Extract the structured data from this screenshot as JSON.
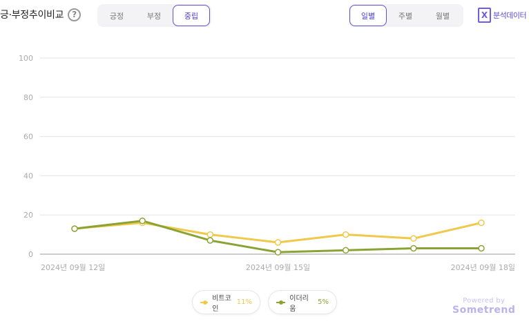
{
  "header": {
    "title": "긍·부정추이비교",
    "help_icon": "?",
    "sentiment_tabs": [
      "긍정",
      "부정",
      "중립"
    ],
    "sentiment_active": "중립",
    "period_tabs": [
      "일별",
      "주별",
      "월별"
    ],
    "period_active": "일별",
    "export_label": "분석데이터",
    "export_icon": "X"
  },
  "legend": [
    {
      "name": "비트코인",
      "value": "11%",
      "color": "#f0c84a"
    },
    {
      "name": "이더리움",
      "value": "5%",
      "color": "#8aa334"
    }
  ],
  "footer": {
    "powered_by": "Powered by",
    "brand": "Sometrend"
  },
  "chart_data": {
    "type": "line",
    "x": [
      "2024-09-12",
      "2024-09-13",
      "2024-09-14",
      "2024-09-15",
      "2024-09-16",
      "2024-09-17",
      "2024-09-18"
    ],
    "x_tick_labels": [
      {
        "index": 0,
        "label": "2024년 09월 12일"
      },
      {
        "index": 3,
        "label": "2024년 09월 15일"
      },
      {
        "index": 6,
        "label": "2024년 09월 18일"
      }
    ],
    "ylim": [
      0,
      100
    ],
    "yticks": [
      0,
      20,
      40,
      60,
      80,
      100
    ],
    "grid": true,
    "series": [
      {
        "name": "비트코인",
        "color": "#f0c84a",
        "values": [
          13,
          16,
          10,
          6,
          10,
          8,
          16
        ]
      },
      {
        "name": "이더리움",
        "color": "#8aa334",
        "values": [
          13,
          17,
          7,
          1,
          2,
          3,
          3
        ]
      }
    ]
  }
}
